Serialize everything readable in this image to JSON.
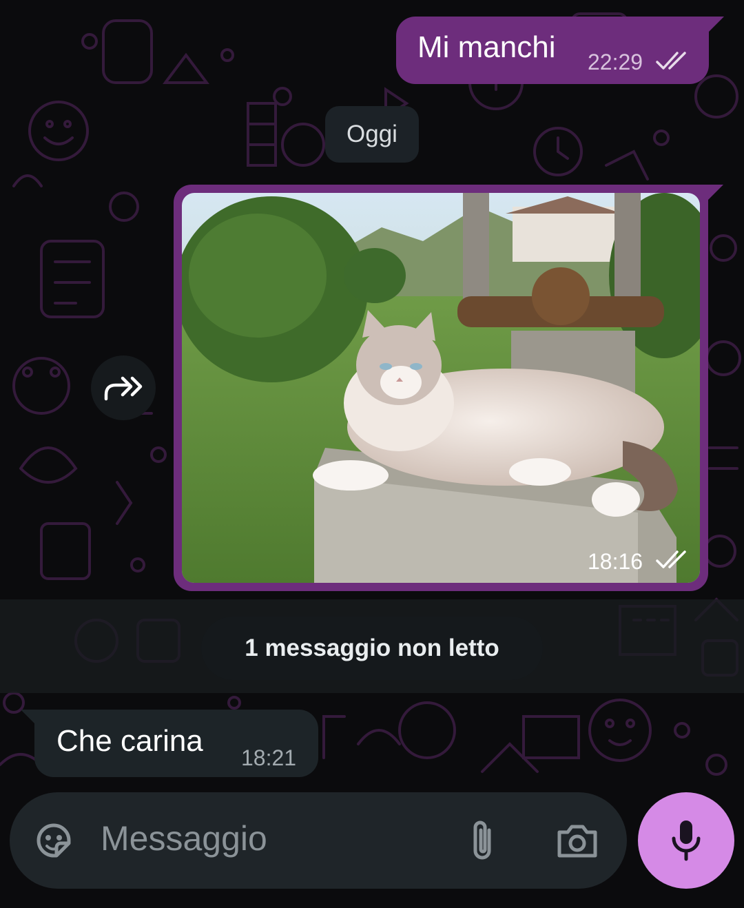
{
  "colors": {
    "outgoing_bubble": "#6d2d7c",
    "incoming_bubble": "#1d2428",
    "mic_button": "#d58ae6",
    "wallpaper_doodle": "#3a1f40"
  },
  "messages": {
    "outgoing_text": {
      "text": "Mi manchi",
      "time": "22:29",
      "status_icon": "double-check-icon"
    },
    "date_divider": "Oggi",
    "outgoing_photo": {
      "time": "18:16",
      "status_icon": "double-check-icon",
      "subject": "cat-photo"
    },
    "unread_divider": "1 messaggio non letto",
    "incoming_text": {
      "text": "Che carina",
      "time": "18:21"
    }
  },
  "composer": {
    "placeholder": "Messaggio",
    "icons": [
      "sticker-icon",
      "paperclip-icon",
      "camera-icon",
      "microphone-icon"
    ]
  },
  "actions": {
    "forward_icon": "forward-icon"
  }
}
